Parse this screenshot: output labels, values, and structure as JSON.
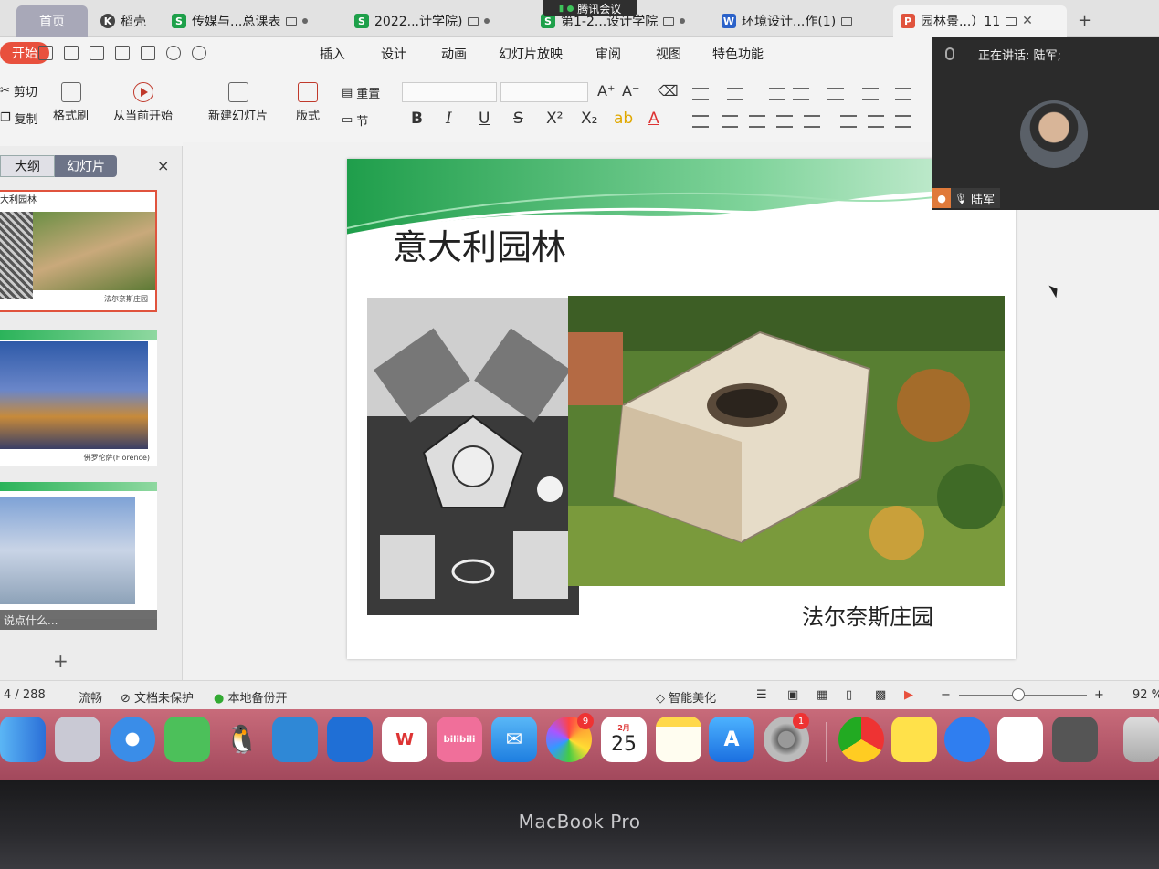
{
  "tabs": [
    {
      "label": "首页",
      "icon": "home",
      "active": false
    },
    {
      "label": "稻壳",
      "icon": "docer-icon",
      "active": false
    },
    {
      "label": "传媒与...总课表",
      "icon": "spreadsheet-icon",
      "active": false
    },
    {
      "label": "2022...计学院)",
      "icon": "spreadsheet-icon",
      "active": false
    },
    {
      "label": "第1-2...设计学院",
      "icon": "spreadsheet-icon",
      "active": false
    },
    {
      "label": "环境设计...作(1)",
      "icon": "word-icon",
      "active": false
    },
    {
      "label": "园林景...）11",
      "icon": "presentation-icon",
      "active": true
    }
  ],
  "tab_icons": {
    "s": "S",
    "w": "W",
    "p": "P",
    "k": "K"
  },
  "meeting_pill": "腾讯会议",
  "menu": {
    "start": "开始",
    "items": [
      "插入",
      "设计",
      "动画",
      "幻灯片放映",
      "审阅",
      "视图",
      "特色功能"
    ]
  },
  "ribbon": {
    "cut": "剪切",
    "copy": "复制",
    "format_painter": "格式刷",
    "play_from_current": "从当前开始",
    "new_slide": "新建幻灯片",
    "layout": "版式",
    "reset": "重置",
    "section": "节",
    "bold": "B",
    "italic": "I",
    "underline": "U",
    "strike": "S",
    "superscript": "X²",
    "subscript": "X₂",
    "grow_font": "A⁺",
    "shrink_font": "A⁻"
  },
  "panel": {
    "tab_outline": "大纲",
    "tab_slides": "幻灯片",
    "close": "×",
    "thumb1_title": "大利园林",
    "thumb1_caption": "法尔奈斯庄园",
    "thumb2_caption": "佛罗伦萨(Florence)",
    "comment_hint": "说点什么...",
    "add": "+"
  },
  "slide": {
    "title": "意大利园林",
    "caption": "法尔奈斯庄园"
  },
  "meeting": {
    "speaking": "正在讲话: 陆军;",
    "user": "陆军"
  },
  "status": {
    "page": "4 / 288",
    "smooth": "流畅",
    "unprotected": "文档未保护",
    "backup": "本地备份开",
    "beautify": "智能美化",
    "zoom": "92 %"
  },
  "dock": {
    "calendar_month": "2月",
    "calendar_day": "25",
    "photos_badge": "9",
    "settings_badge": "1",
    "bilibili": "bilibili"
  },
  "brand": "MacBook Pro",
  "colors": {
    "accent": "#e8503d",
    "slide_green": "#2bb35a"
  }
}
